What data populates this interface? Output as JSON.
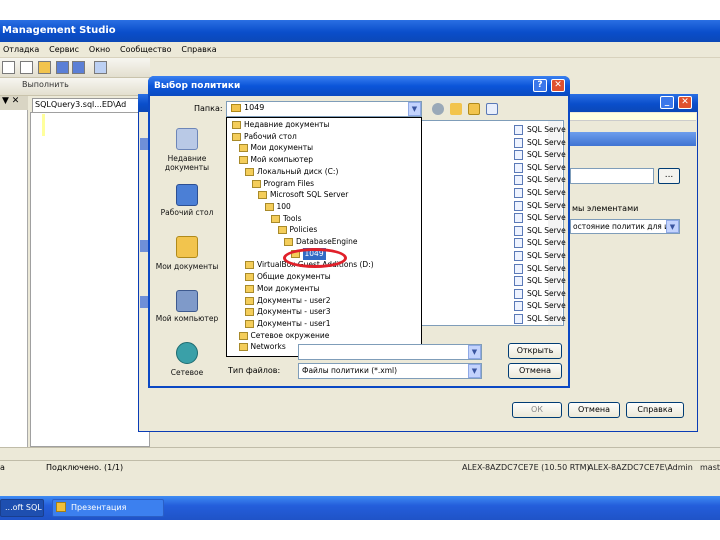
{
  "ssms": {
    "title": "Management Studio",
    "menu": [
      "Отладка",
      "Сервис",
      "Окно",
      "Сообщество",
      "Справка"
    ],
    "execute_label": "Выполнить",
    "query_tab": "SQLQuery3.sql...ED\\Ad",
    "left_header": "▼ ✕",
    "status_left": "a",
    "status_text": "Подключено. (1/1)",
    "status_server": "ALEX-8AZDC7CE7E (10.50 RTM)",
    "status_user": "ALEX-8AZDC7CE7E\\Admin",
    "status_db": "master"
  },
  "taskbar": {
    "ssms_task": "...oft SQL ...",
    "ppt_task": "Презентация"
  },
  "policy_dialog": {
    "browse_label": "...",
    "compare_label": "мы элементами",
    "select_value": "остояние политик для и",
    "ok_label": "ОК",
    "cancel_label": "Отмена",
    "help_label": "Справка"
  },
  "open_dialog": {
    "title": "Выбор политики",
    "help_btn": "?",
    "close_btn": "✕",
    "lookin_label": "Папка:",
    "lookin_value": "1049",
    "places": [
      {
        "label": "Недавние документы"
      },
      {
        "label": "Рабочий стол"
      },
      {
        "label": "Мои документы"
      },
      {
        "label": "Мой компьютер"
      },
      {
        "label": "Сетевое"
      }
    ],
    "dropdown": [
      {
        "label": "Недавние документы",
        "indent": 0
      },
      {
        "label": "Рабочий стол",
        "indent": 0
      },
      {
        "label": "Мои документы",
        "indent": 1
      },
      {
        "label": "Мой компьютер",
        "indent": 1
      },
      {
        "label": "Локальный диск (C:)",
        "indent": 2
      },
      {
        "label": "Program Files",
        "indent": 3
      },
      {
        "label": "Microsoft SQL Server",
        "indent": 4
      },
      {
        "label": "100",
        "indent": 5
      },
      {
        "label": "Tools",
        "indent": 6
      },
      {
        "label": "Policies",
        "indent": 7
      },
      {
        "label": "DatabaseEngine",
        "indent": 8
      },
      {
        "label": "1049",
        "indent": 9,
        "selected": true
      },
      {
        "label": "VirtualBox Guest Additions (D:)",
        "indent": 2
      },
      {
        "label": "Общие документы",
        "indent": 2
      },
      {
        "label": "Мои документы",
        "indent": 2
      },
      {
        "label": "Документы - user2",
        "indent": 2
      },
      {
        "label": "Документы - user3",
        "indent": 2
      },
      {
        "label": "Документы - user1",
        "indent": 2
      },
      {
        "label": "Сетевое окружение",
        "indent": 1
      },
      {
        "label": "Networks",
        "indent": 1
      }
    ],
    "files": [
      "SQL Serve",
      "SQL Serve",
      "SQL Serve",
      "SQL Serve",
      "SQL Serve",
      "SQL Serve",
      "SQL Serve",
      "SQL Serve",
      "SQL Serve",
      "SQL Serve",
      "SQL Serve",
      "SQL Serve",
      "SQL Serve",
      "SQL Serve",
      "SQL Serve",
      "SQL Serve"
    ],
    "filetype_label": "Тип файлов:",
    "filetype_value": "Файлы политики (*.xml)",
    "open_label": "Открыть",
    "cancel_label": "Отмена"
  },
  "colors": {
    "xp_blue": "#0b55d9",
    "selection": "#316ac5",
    "annotation_red": "#e0202a"
  }
}
